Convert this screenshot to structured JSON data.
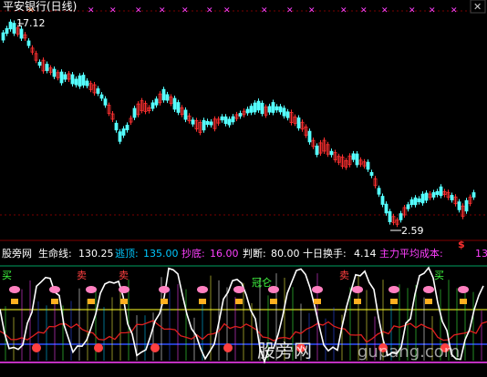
{
  "window": {
    "title": "平安银行(日线)",
    "close_glyph": "✕"
  },
  "main_chart": {
    "high_label": "17.12",
    "low_label": "2.59",
    "signal_glyph": "$",
    "marker_glyph": "✕"
  },
  "indicator": {
    "name": "股旁网",
    "params": [
      {
        "label": "生命线:",
        "value": "130.25",
        "color": "#ffffff"
      },
      {
        "label": "逃顶:",
        "value": "135.00",
        "color": "#00c8ff"
      },
      {
        "label": "抄底:",
        "value": "16.00",
        "color": "#ff40ff"
      },
      {
        "label": "判断:",
        "value": "80.00",
        "color": "#ffffff"
      },
      {
        "label": "十日换手:",
        "value": "4.14",
        "color": "#ffffff"
      },
      {
        "label": "主力平均成本:",
        "value": "13",
        "color": "#ff40ff"
      }
    ],
    "signals": {
      "buy": "买",
      "sell": "卖",
      "top": "冠仑"
    }
  },
  "watermarks": [
    "股旁网",
    "gupang.com"
  ],
  "colors": {
    "background": "#000000",
    "up_candle": "#ff3030",
    "down_candle": "#54ffff",
    "grid": "#800000",
    "life_line": "#ffffff",
    "escape_top": "#00c8ff",
    "bottom_pick": "#ff40ff"
  }
}
